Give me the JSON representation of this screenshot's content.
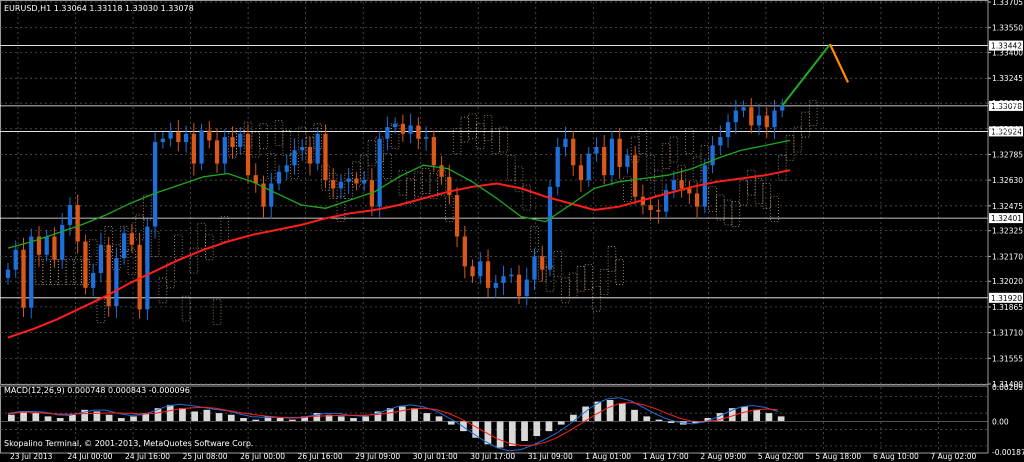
{
  "chart_header": "EURUSD,H1  1.33064 1.33118 1.33030 1.33078",
  "macd_header": "MACD(12,26,9) 0.000748 0.000843 -0.000096",
  "copyright": "Skopalino Terminal, © 2001-2013, MetaQuotes Software Corp.",
  "colors": {
    "background": "#000000",
    "grid": "#5f5f5f",
    "bull": "#1e6fd9",
    "bear": "#d9591b",
    "ma_red": "#ff1e1e",
    "ma_green": "#1fa81f",
    "ichimoku_cloud": "#f1c8a0",
    "forecast_up": "#22aa22",
    "forecast_down": "#ff8c00",
    "hline": "#ffffff"
  },
  "chart_data": [
    {
      "type": "line",
      "name": "EURUSD H1 price",
      "title": "EURUSD,H1  1.33064 1.33118 1.33030 1.33078",
      "ylim": [
        1.314,
        1.33705
      ],
      "y_ticks": [
        "1.33705",
        "1.33550",
        "1.33400",
        "1.33245",
        "1.33095",
        "1.32940",
        "1.32785",
        "1.32630",
        "1.32475",
        "1.32325",
        "1.32170",
        "1.32020",
        "1.31865",
        "1.31710",
        "1.31555",
        "1.31400"
      ],
      "x_ticks": [
        "23 Jul 2013",
        "24 Jul 00:00",
        "24 Jul 16:00",
        "25 Jul 08:00",
        "26 Jul 00:00",
        "26 Jul 16:00",
        "29 Jul 09:00",
        "30 Jul 01:00",
        "30 Jul 17:00",
        "31 Jul 09:00",
        "1 Aug 01:00",
        "1 Aug 17:00",
        "2 Aug 09:00",
        "5 Aug 02:00",
        "5 Aug 18:00",
        "6 Aug 10:00",
        "7 Aug 02:00"
      ],
      "horizontal_levels": [
        {
          "label": "1.33442",
          "value": 1.33442
        },
        {
          "label": "1.33078",
          "value": 1.33078
        },
        {
          "label": "1.32924",
          "value": 1.32924
        },
        {
          "label": "1.32401",
          "value": 1.32401
        },
        {
          "label": "1.31920",
          "value": 1.3192
        }
      ],
      "close_series": [
        1.3209,
        1.3221,
        1.3186,
        1.3229,
        1.3218,
        1.3229,
        1.3215,
        1.3236,
        1.3248,
        1.3226,
        1.3198,
        1.3207,
        1.3224,
        1.3187,
        1.3216,
        1.3231,
        1.3224,
        1.3185,
        1.3235,
        1.3286,
        1.3288,
        1.3292,
        1.3286,
        1.3291,
        1.3273,
        1.3293,
        1.3287,
        1.3273,
        1.3289,
        1.3283,
        1.3291,
        1.3266,
        1.3261,
        1.3247,
        1.3261,
        1.3268,
        1.3272,
        1.3281,
        1.3283,
        1.3273,
        1.3291,
        1.3263,
        1.3258,
        1.3262,
        1.3264,
        1.3261,
        1.3263,
        1.3247,
        1.3288,
        1.3295,
        1.3297,
        1.3291,
        1.3296,
        1.3288,
        1.3289,
        1.3272,
        1.3265,
        1.3254,
        1.3229,
        1.3211,
        1.3205,
        1.3214,
        1.3198,
        1.3201,
        1.3205,
        1.3206,
        1.3193,
        1.3203,
        1.3217,
        1.3209,
        1.3259,
        1.3283,
        1.3288,
        1.3272,
        1.3263,
        1.3279,
        1.3283,
        1.3266,
        1.3288,
        1.3271,
        1.3278,
        1.3253,
        1.3248,
        1.3245,
        1.3244,
        1.3257,
        1.3263,
        1.3258,
        1.3255,
        1.3247,
        1.3272,
        1.3284,
        1.3289,
        1.3298,
        1.3305,
        1.3307,
        1.3296,
        1.3302,
        1.3295,
        1.3305,
        1.3308
      ],
      "series": [
        {
          "name": "MA red",
          "values": [
            1.3168,
            1.3173,
            1.3179,
            1.3186,
            1.3193,
            1.3201,
            1.3208,
            1.3215,
            1.3221,
            1.3226,
            1.323,
            1.3233,
            1.3236,
            1.324,
            1.3243,
            1.3245,
            1.3248,
            1.3252,
            1.3256,
            1.3259,
            1.3261,
            1.3258,
            1.3253,
            1.3249,
            1.3245,
            1.3247,
            1.3251,
            1.3255,
            1.3259,
            1.3262,
            1.3264,
            1.3266,
            1.3269
          ]
        },
        {
          "name": "MA green",
          "values": [
            1.3222,
            1.3226,
            1.3231,
            1.3236,
            1.3242,
            1.3249,
            1.3255,
            1.326,
            1.3265,
            1.3267,
            1.3262,
            1.3255,
            1.3248,
            1.3246,
            1.3251,
            1.3256,
            1.3265,
            1.3272,
            1.327,
            1.3262,
            1.3252,
            1.3241,
            1.3238,
            1.3248,
            1.3258,
            1.3262,
            1.3264,
            1.3266,
            1.327,
            1.3276,
            1.3281,
            1.3284,
            1.3287
          ]
        }
      ],
      "forecast": {
        "up_to": 1.3345,
        "down_to": 1.3322
      }
    },
    {
      "type": "bar",
      "name": "MACD(12,26,9)",
      "title": "MACD(12,26,9) 0.000748 0.000843 -0.000096",
      "ylim": [
        -0.00187,
        0.00209
      ],
      "y_ticks": [
        "0.00209",
        "0.00",
        "-0.00187"
      ],
      "histogram": [
        0.0004,
        0.0006,
        0.0005,
        0.0003,
        0.0002,
        0.0004,
        0.0007,
        0.0006,
        0.0004,
        0.0002,
        0.0003,
        0.0005,
        0.0008,
        0.001,
        0.0008,
        0.0006,
        0.0007,
        0.0005,
        0.0004,
        0.0002,
        0.0001,
        0.0003,
        0.0002,
        0.0001,
        0.0003,
        0.0005,
        0.0004,
        0.0003,
        0.0002,
        0.0003,
        0.0006,
        0.0008,
        0.0009,
        0.0008,
        0.0005,
        0.0003,
        -0.0002,
        -0.0006,
        -0.001,
        -0.0014,
        -0.0016,
        -0.0015,
        -0.0012,
        -0.0009,
        -0.0006,
        -0.0002,
        0.0004,
        0.0009,
        0.0012,
        0.0013,
        0.0011,
        0.0007,
        0.0003,
        0.0001,
        -0.0001,
        -0.0002,
        -0.0001,
        0.0002,
        0.0005,
        0.0008,
        0.0009,
        0.0007,
        0.0005,
        0.0003
      ]
    }
  ]
}
